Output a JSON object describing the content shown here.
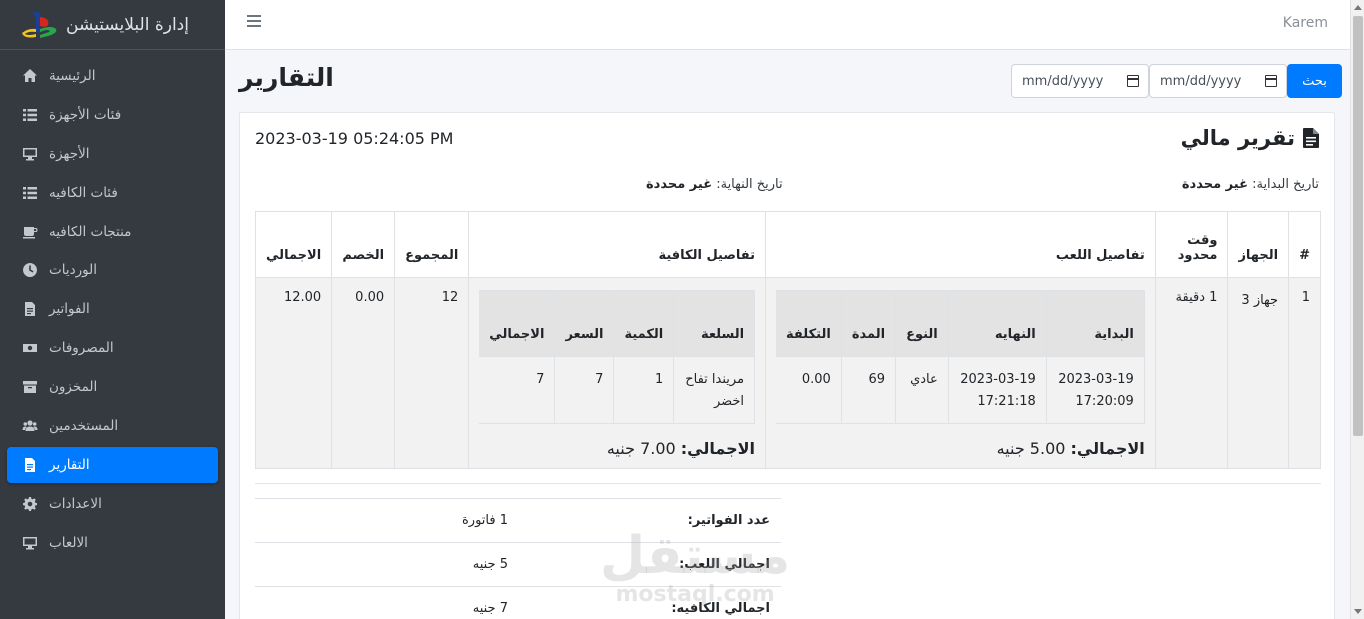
{
  "brand": {
    "title": "إدارة البلايستيشن"
  },
  "sidebar": {
    "items": [
      {
        "label": "الرئيسية",
        "icon": "home-icon"
      },
      {
        "label": "فئات الأجهزة",
        "icon": "list-icon"
      },
      {
        "label": "الأجهزة",
        "icon": "desktop-icon"
      },
      {
        "label": "فئات الكافيه",
        "icon": "list-icon"
      },
      {
        "label": "منتجات الكافيه",
        "icon": "coffee-icon"
      },
      {
        "label": "الورديات",
        "icon": "clock-icon"
      },
      {
        "label": "الفواتير",
        "icon": "invoice-icon"
      },
      {
        "label": "المصروفات",
        "icon": "money-icon"
      },
      {
        "label": "المخزون",
        "icon": "box-icon"
      },
      {
        "label": "المستخدمين",
        "icon": "users-icon"
      },
      {
        "label": "التقارير",
        "icon": "file-icon",
        "active": true
      },
      {
        "label": "الاعدادات",
        "icon": "gear-icon"
      },
      {
        "label": "الالعاب",
        "icon": "desktop-icon"
      }
    ]
  },
  "topbar": {
    "user": "Karem"
  },
  "page": {
    "title": "التقارير"
  },
  "filters": {
    "from_placeholder": "mm/dd/yyyy",
    "to_placeholder": "mm/dd/yyyy",
    "search_label": "بحث"
  },
  "report": {
    "title": "تقرير مالي",
    "generated_at": "2023-03-19 05:24:05 PM",
    "start_label": "تاريخ البداية:",
    "start_value": "غير محددة",
    "end_label": "تاريخ النهاية:",
    "end_value": "غير محددة",
    "columns": {
      "num": "#",
      "device": "الجهاز",
      "time": "وقت محدود",
      "game_details": "تفاصيل اللعب",
      "cafe_details": "تفاصيل الكافية",
      "sum": "المجموع",
      "discount": "الخصم",
      "total": "الاجمالي"
    },
    "row": {
      "num": "1",
      "device": "جهاز 3",
      "time": "1 دقيقة",
      "game": {
        "headers": {
          "start": "البداية",
          "end": "النهايه",
          "type": "النوع",
          "duration": "المدة",
          "cost": "التكلفة"
        },
        "rows": [
          {
            "start": "2023-03-19 17:20:09",
            "end": "2023-03-19 17:21:18",
            "type": "عادي",
            "duration": "69",
            "cost": "0.00"
          }
        ],
        "total_label": "الاجمالي:",
        "total_value": "5.00 جنيه"
      },
      "cafe": {
        "headers": {
          "item": "السلعة",
          "qty": "الكمية",
          "price": "السعر",
          "total": "الاجمالي"
        },
        "rows": [
          {
            "item": "مريندا تفاح اخضر",
            "qty": "1",
            "price": "7",
            "total": "7"
          }
        ],
        "total_label": "الاجمالي:",
        "total_value": "7.00 جنيه"
      },
      "sum": "12",
      "discount": "0.00",
      "total": "12.00"
    },
    "summary": [
      {
        "label": "عدد الفواتير:",
        "value": "1 فاتورة"
      },
      {
        "label": "اجمالي اللعب:",
        "value": "5 جنيه"
      },
      {
        "label": "اجمالي الكافيه:",
        "value": "7 جنيه"
      }
    ]
  },
  "watermark": {
    "ar": "مستقل",
    "en": "mostaql.com"
  },
  "colors": {
    "sidebar": "#343a40",
    "accent": "#007bff",
    "background": "#f4f6f9"
  }
}
